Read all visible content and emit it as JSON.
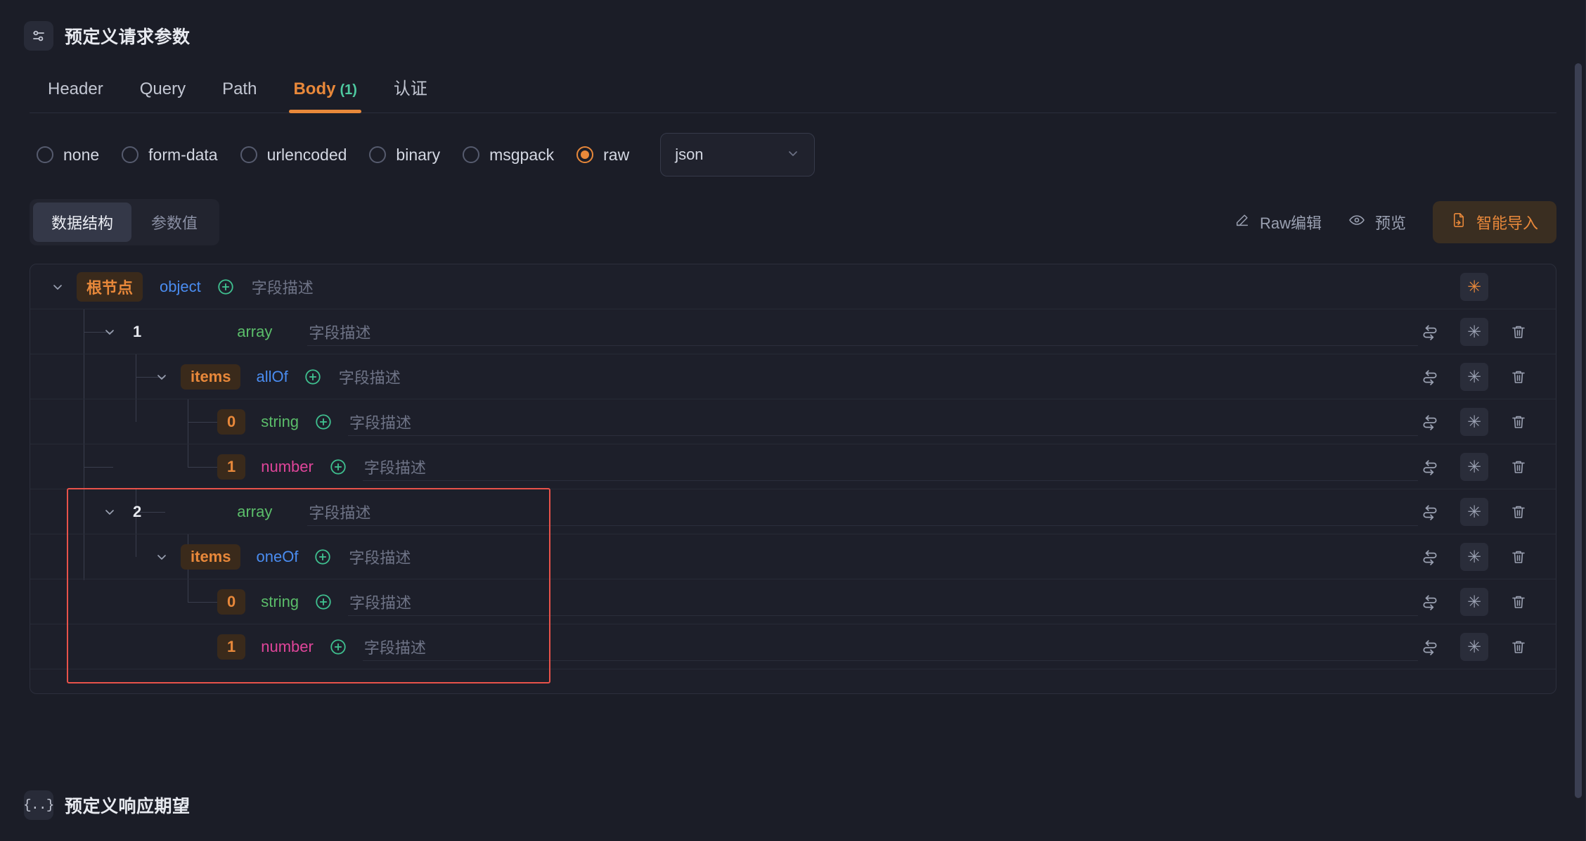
{
  "request_section": {
    "icon": "sliders-icon",
    "title": "预定义请求参数"
  },
  "tabs": [
    {
      "label": "Header",
      "count": "",
      "active": false
    },
    {
      "label": "Query",
      "count": "",
      "active": false
    },
    {
      "label": "Path",
      "count": "",
      "active": false
    },
    {
      "label": "Body",
      "count": "(1)",
      "active": true
    },
    {
      "label": "认证",
      "count": "",
      "active": false
    }
  ],
  "body_types": [
    {
      "label": "none",
      "checked": false
    },
    {
      "label": "form-data",
      "checked": false
    },
    {
      "label": "urlencoded",
      "checked": false
    },
    {
      "label": "binary",
      "checked": false
    },
    {
      "label": "msgpack",
      "checked": false
    },
    {
      "label": "raw",
      "checked": true
    }
  ],
  "format_select": {
    "value": "json",
    "icon": "chevron-down-icon"
  },
  "toolbar": {
    "segments": [
      {
        "label": "数据结构",
        "active": true
      },
      {
        "label": "参数值",
        "active": false
      }
    ],
    "raw_edit_label": "Raw编辑",
    "raw_edit_icon": "pencil-icon",
    "preview_label": "预览",
    "preview_icon": "eye-icon",
    "smart_import_label": "智能导入",
    "smart_import_icon": "import-file-icon"
  },
  "colors": {
    "accent": "#e8883a",
    "green": "#5bbd6a",
    "blue": "#4a8cf0",
    "pink": "#e0459a",
    "teal": "#4ec9a0",
    "highlight_border": "#e8524a"
  },
  "tree": {
    "description_placeholder": "字段描述",
    "rows": [
      {
        "depth": 0,
        "twisty": "chevron-down-icon",
        "key": "根节点",
        "key_style": "root",
        "type": "object",
        "type_class": "object",
        "has_plus": true,
        "desc": "字段描述",
        "actions": [
          "star-on"
        ]
      },
      {
        "depth": 1,
        "twisty": "chevron-down-icon",
        "key": "1",
        "key_style": "plain",
        "type": "array",
        "type_class": "array",
        "has_plus": false,
        "desc": "字段描述",
        "actions": [
          "swap",
          "star",
          "trash"
        ]
      },
      {
        "depth": 2,
        "twisty": "chevron-down-icon",
        "key": "items",
        "key_style": "items",
        "type": "allOf",
        "type_class": "allOf",
        "has_plus": true,
        "desc": "字段描述",
        "actions": [
          "swap",
          "star",
          "trash"
        ]
      },
      {
        "depth": 3,
        "twisty": "",
        "key": "0",
        "key_style": "idx",
        "type": "string",
        "type_class": "string",
        "has_plus": true,
        "desc": "字段描述",
        "actions": [
          "swap",
          "star",
          "trash"
        ]
      },
      {
        "depth": 3,
        "twisty": "",
        "key": "1",
        "key_style": "idx",
        "type": "number",
        "type_class": "number",
        "has_plus": true,
        "desc": "字段描述",
        "actions": [
          "swap",
          "star",
          "trash"
        ]
      },
      {
        "depth": 1,
        "twisty": "chevron-down-icon",
        "key": "2",
        "key_style": "plain",
        "type": "array",
        "type_class": "array",
        "has_plus": false,
        "desc": "字段描述",
        "actions": [
          "swap",
          "star",
          "trash"
        ]
      },
      {
        "depth": 2,
        "twisty": "chevron-down-icon",
        "key": "items",
        "key_style": "items",
        "type": "oneOf",
        "type_class": "oneOf",
        "has_plus": true,
        "desc": "字段描述",
        "actions": [
          "swap",
          "star",
          "trash"
        ]
      },
      {
        "depth": 3,
        "twisty": "",
        "key": "0",
        "key_style": "idx",
        "type": "string",
        "type_class": "string",
        "has_plus": true,
        "desc": "字段描述",
        "actions": [
          "swap",
          "star",
          "trash"
        ]
      },
      {
        "depth": 3,
        "twisty": "",
        "key": "1",
        "key_style": "idx",
        "type": "number",
        "type_class": "number",
        "has_plus": true,
        "desc": "字段描述",
        "actions": [
          "swap",
          "star",
          "trash"
        ]
      }
    ]
  },
  "response_section": {
    "icon": "braces-icon",
    "title": "预定义响应期望"
  }
}
